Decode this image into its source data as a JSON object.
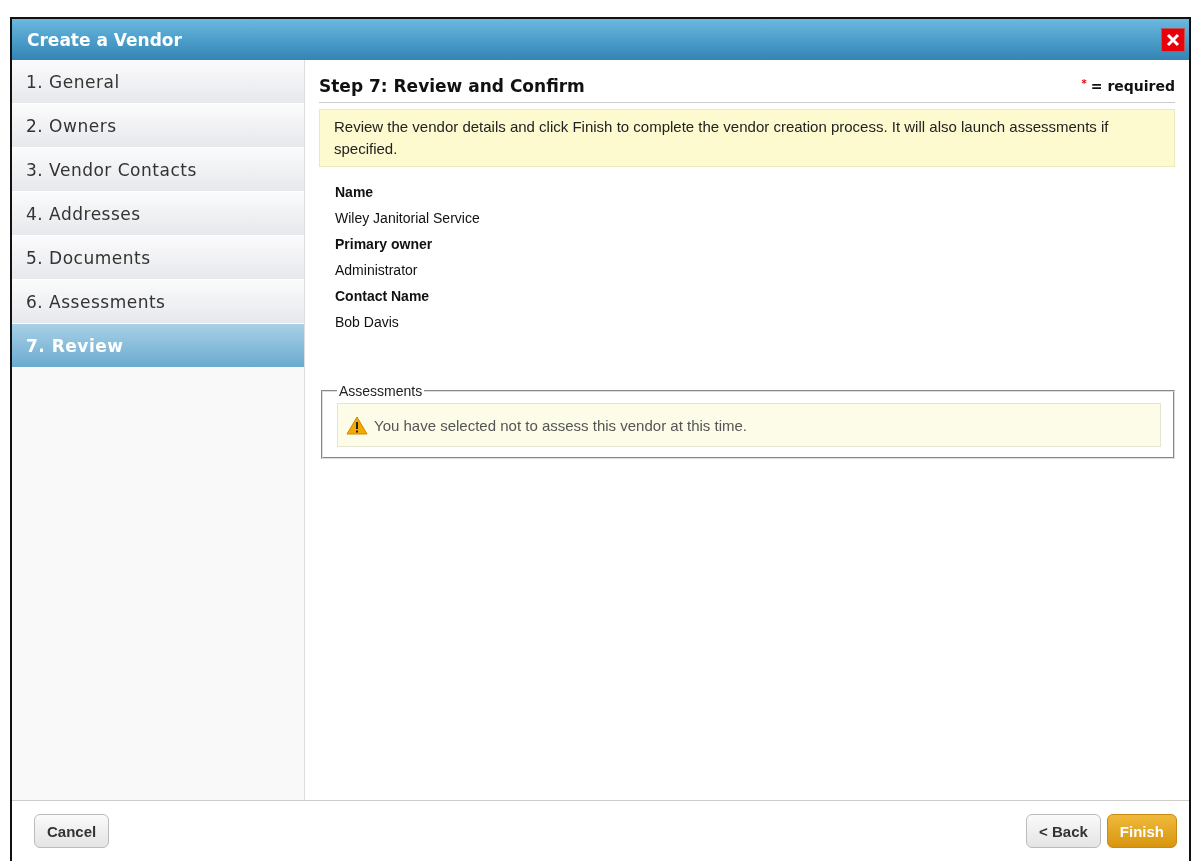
{
  "window": {
    "title": "Create a Vendor"
  },
  "steps": [
    {
      "label": "1. General",
      "selected": false
    },
    {
      "label": "2. Owners",
      "selected": false
    },
    {
      "label": "3. Vendor Contacts",
      "selected": false
    },
    {
      "label": "4. Addresses",
      "selected": false
    },
    {
      "label": "5. Documents",
      "selected": false
    },
    {
      "label": "6. Assessments",
      "selected": false
    },
    {
      "label": "7. Review",
      "selected": true
    }
  ],
  "heading": "Step 7: Review and Confirm",
  "required_mark": "*",
  "required_note": "= required",
  "info": "Review the vendor details and click Finish to complete the vendor creation process. It will also launch assessments if specified.",
  "details": [
    {
      "label": "Name",
      "value": "Wiley Janitorial Service"
    },
    {
      "label": "Primary owner",
      "value": "Administrator"
    },
    {
      "label": "Contact Name",
      "value": "Bob Davis"
    }
  ],
  "assessments": {
    "legend": "Assessments",
    "message": "You have selected not to assess this vendor at this time."
  },
  "buttons": [
    {
      "label": "Cancel",
      "kind": "secondary"
    },
    {
      "label": "< Back",
      "kind": "secondary"
    },
    {
      "label": "Finish",
      "kind": "primary"
    }
  ]
}
